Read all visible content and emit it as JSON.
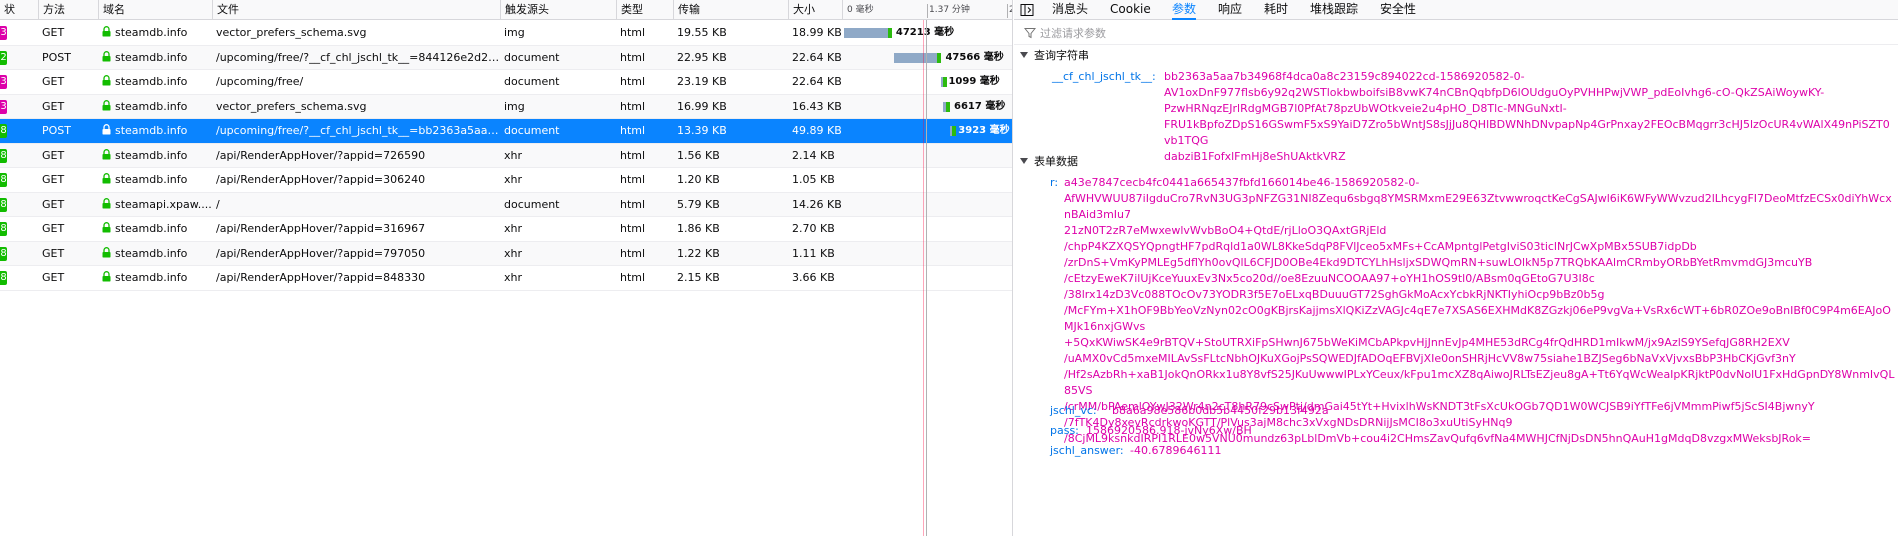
{
  "colors": {
    "accent": "#0a84ff",
    "key": "#0074e8",
    "value": "#dd00a9",
    "status_3xx": "#dd00a9",
    "status_2xx": "#12bc00",
    "lock": "#12bc00"
  },
  "list": {
    "headers": {
      "status": "状",
      "method": "方法",
      "domain": "域名",
      "file": "文件",
      "cause": "触发源头",
      "type": "类型",
      "transferred": "传输",
      "size": "大小"
    },
    "timeline_ticks": [
      "0 毫秒",
      "1.37 分钟",
      "2"
    ],
    "rows": [
      {
        "status": "3",
        "status_color": "#dd00a9",
        "method": "GET",
        "domain": "steamdb.info",
        "file": "vector_prefers_schema.svg",
        "cause": "img",
        "type": "html",
        "transferred": "19.55 KB",
        "size": "18.99 KB",
        "timing": "47213 毫秒",
        "bar_start": 0.0,
        "bar_end": 0.28
      },
      {
        "status": "2",
        "status_color": "#12bc00",
        "method": "POST",
        "domain": "steamdb.info",
        "file": "/upcoming/free/?__cf_chl_jschl_tk__=844126e2d217...",
        "cause": "document",
        "type": "html",
        "transferred": "22.95 KB",
        "size": "22.64 KB",
        "timing": "47566 毫秒",
        "bar_start": 0.29,
        "bar_end": 0.57
      },
      {
        "status": "3",
        "status_color": "#dd00a9",
        "method": "GET",
        "domain": "steamdb.info",
        "file": "/upcoming/free/",
        "cause": "document",
        "type": "html",
        "transferred": "23.19 KB",
        "size": "22.64 KB",
        "timing": "1099 毫秒",
        "bar_start": 0.57,
        "bar_end": 0.58
      },
      {
        "status": "3",
        "status_color": "#dd00a9",
        "method": "GET",
        "domain": "steamdb.info",
        "file": "vector_prefers_schema.svg",
        "cause": "img",
        "type": "html",
        "transferred": "16.99 KB",
        "size": "16.43 KB",
        "timing": "6617 毫秒",
        "bar_start": 0.58,
        "bar_end": 0.62
      },
      {
        "status": "8",
        "status_color": "#12bc00",
        "method": "POST",
        "domain": "steamdb.info",
        "file": "/upcoming/free/?__cf_chl_jschl_tk__=bb2363a5aa7...",
        "cause": "document",
        "type": "html",
        "transferred": "13.39 KB",
        "size": "49.89 KB",
        "timing": "3923 毫秒",
        "bar_start": 0.62,
        "bar_end": 0.645
      },
      {
        "status": "8",
        "status_color": "#12bc00",
        "method": "GET",
        "domain": "steamdb.info",
        "file": "/api/RenderAppHover/?appid=726590",
        "cause": "xhr",
        "type": "html",
        "transferred": "1.56 KB",
        "size": "2.14 KB",
        "timing": "",
        "bar_start": 0,
        "bar_end": 0
      },
      {
        "status": "8",
        "status_color": "#12bc00",
        "method": "GET",
        "domain": "steamdb.info",
        "file": "/api/RenderAppHover/?appid=306240",
        "cause": "xhr",
        "type": "html",
        "transferred": "1.20 KB",
        "size": "1.05 KB",
        "timing": "",
        "bar_start": 0,
        "bar_end": 0
      },
      {
        "status": "8",
        "status_color": "#12bc00",
        "method": "GET",
        "domain": "steamapi.xpaw....",
        "file": "/",
        "cause": "document",
        "type": "html",
        "transferred": "5.79 KB",
        "size": "14.26 KB",
        "timing": "",
        "bar_start": 0,
        "bar_end": 0
      },
      {
        "status": "8",
        "status_color": "#12bc00",
        "method": "GET",
        "domain": "steamdb.info",
        "file": "/api/RenderAppHover/?appid=316967",
        "cause": "xhr",
        "type": "html",
        "transferred": "1.86 KB",
        "size": "2.70 KB",
        "timing": "",
        "bar_start": 0,
        "bar_end": 0
      },
      {
        "status": "8",
        "status_color": "#12bc00",
        "method": "GET",
        "domain": "steamdb.info",
        "file": "/api/RenderAppHover/?appid=797050",
        "cause": "xhr",
        "type": "html",
        "transferred": "1.22 KB",
        "size": "1.11 KB",
        "timing": "",
        "bar_start": 0,
        "bar_end": 0
      },
      {
        "status": "8",
        "status_color": "#12bc00",
        "method": "GET",
        "domain": "steamdb.info",
        "file": "/api/RenderAppHover/?appid=848330",
        "cause": "xhr",
        "type": "html",
        "transferred": "2.15 KB",
        "size": "3.66 KB",
        "timing": "",
        "bar_start": 0,
        "bar_end": 0
      }
    ],
    "selected_index": 4
  },
  "detail": {
    "tabs": [
      "消息头",
      "Cookie",
      "参数",
      "响应",
      "耗时",
      "堆栈跟踪",
      "安全性"
    ],
    "active_tab": 2,
    "filter_placeholder": "过滤请求参数",
    "query_section": "查询字符串",
    "query_params": [
      {
        "key": "__cf_chl_jschl_tk__:",
        "value": "bb2363a5aa7b34968f4dca0a8c23159c894022cd-1586920582-0-\nAV1oxDnF977flsb6y92q2WSTlokbwboifsiB8vwK74nCBnQqbfpD6lOUdguOyPVHHPwjVWP_pdEoIvhg6-cO-QkZSAiWoywKY-\nPzwHRNqzEJrlRdgMGB7l0PfAt78pzUbWOtkveie2u4pHO_D8Tlc-MNGuNxtI-\nFRU1kBpfoZDpS16GSwmF5xS9YaiD7Zro5bWntJS8sJjJu8QHlBDWNhDNvpapNp4GrPnxay2FEOcBMqgrr3cHJ5lzOcUR4vWAlX49nPiSZT0vb1TQG\ndabziB1FofxlFmHj8eShUAktkVRZ"
      }
    ],
    "form_section": "表单数据",
    "form_params": [
      {
        "key": "r:",
        "value": "a43e7847cecb4fc0441a665437fbfd166014be46-1586920582-0-\nAfWHVWUU87iIgduCro7RvN3UG3pNFZG31NI8Zequ6sbgq8YMSRMxmE29E63ZtvwwroqctKeCgSAJwl6iK6WFyWWvzud2lLhcygFI7DeoMtfzECSx0diYhWcxnBAid3mIu7\n21zN0T2zR7eMwxewlvWvbBoO4+QtdE/rjLloO3QAxtGRjEld\n/chpP4KZXQSYQpngtHF7pdRqld1a0WL8KkeSdqP8FVlJceo5xMFs+CcAMpntglPetgIviS03ticlNrJCwXpMBx5SUB7idpDb\n/zrDnS+VmKyPMLEg5dflYh0ovQlL6CFJD0OBe4Ekd9DTCYLhHsljxSDWQmRN+suwLOlkN5p7TRQbKAAlmCRmbyORbBYetRmvmdGJ3mcuYB\n/cEtzyEweK7ilUjKceYuuxEv3Nx5co20d//oe8EzuuNCOOAA97+oYH1hOS9tl0/ABsm0qGEtoG7U3I8c\n/38lrx14zD3Vc088TOcOv73YODR3f5E7oELxqBDuuuGT72SghGkMoAcxYcbkRjNKTIyhiOcp9bBz0b5g\n/McFYm+X1hOF9BbYeoVzNyn02cO0gKBjrsKajjmsXlQKiZzVAGJc4qE7e7XSAS6EXHMdK8ZGzkj06eP9vgVa+VsRx6cWT+6bR0ZOe9oBnIBf0C9P4m6EAJoOMJk16nxjGWvs\n+5QxKWiwSK4e9rBTQV+StoUTRXiFpSHwnJ675bWeKiMCbAPkpvHjJnnEvJp4MHE53dRCg4frQdHRD1mIkwM/jx9AzlS9YSefqJG8RH2EXV\n/uAMX0vCd5mxeMILAvSsFLtcNbhOJKuXGojPsSQWEDJfADOqEFBVjXIe0onSHRjHcVV8w75siahe1BZJSeg6bNaVxVjvxsBbP3HbCKjGvf3nY\n/Hf2sAzbRh+xaB1JokQnORkx1u8Y8vfS25JKuUwwwIPLxYCeux/kFpu1mcXZ8qAiwoJRLTsEZjeu8gA+Tt6YqWcWeaIpKRjktP0dvNolU1FxHdGpnDY8WnmIvQL85VS\n/crMM/bPAemlOYwJ32Wr4n2cT8hR79cSwPtj/dmGai45tYt+HvixlhWsKNDT3tFsXcUkOGb7QD1W0WCJSB9iYfTFe6jVMmmPiwf5jScSI4BjwnyY\n/7fTK4Dy8xevRcdrkwoKGTT/PlVus3ajM8chc3xVxgNDsDRNijJsMCI8o3xuUtiSyHNq9\n/8CjML9ksnkdIRPI1RLE0w5VNU0mundz63pLblDmVb+cou4i2CHmsZavQufq6vfNa4MWHJCfNjDsDN5hnQAuH1gMdqD8vzgxMWeksbJRok="
      },
      {
        "key": "jschl_vc:",
        "value": "b8a6a98e586b0db5b4450f29b13f492a"
      },
      {
        "key": "pass:",
        "value": "1586920586.918-jvNy6Xw/BH"
      },
      {
        "key": "jschl_answer:",
        "value": "-40.6789646111"
      }
    ]
  }
}
